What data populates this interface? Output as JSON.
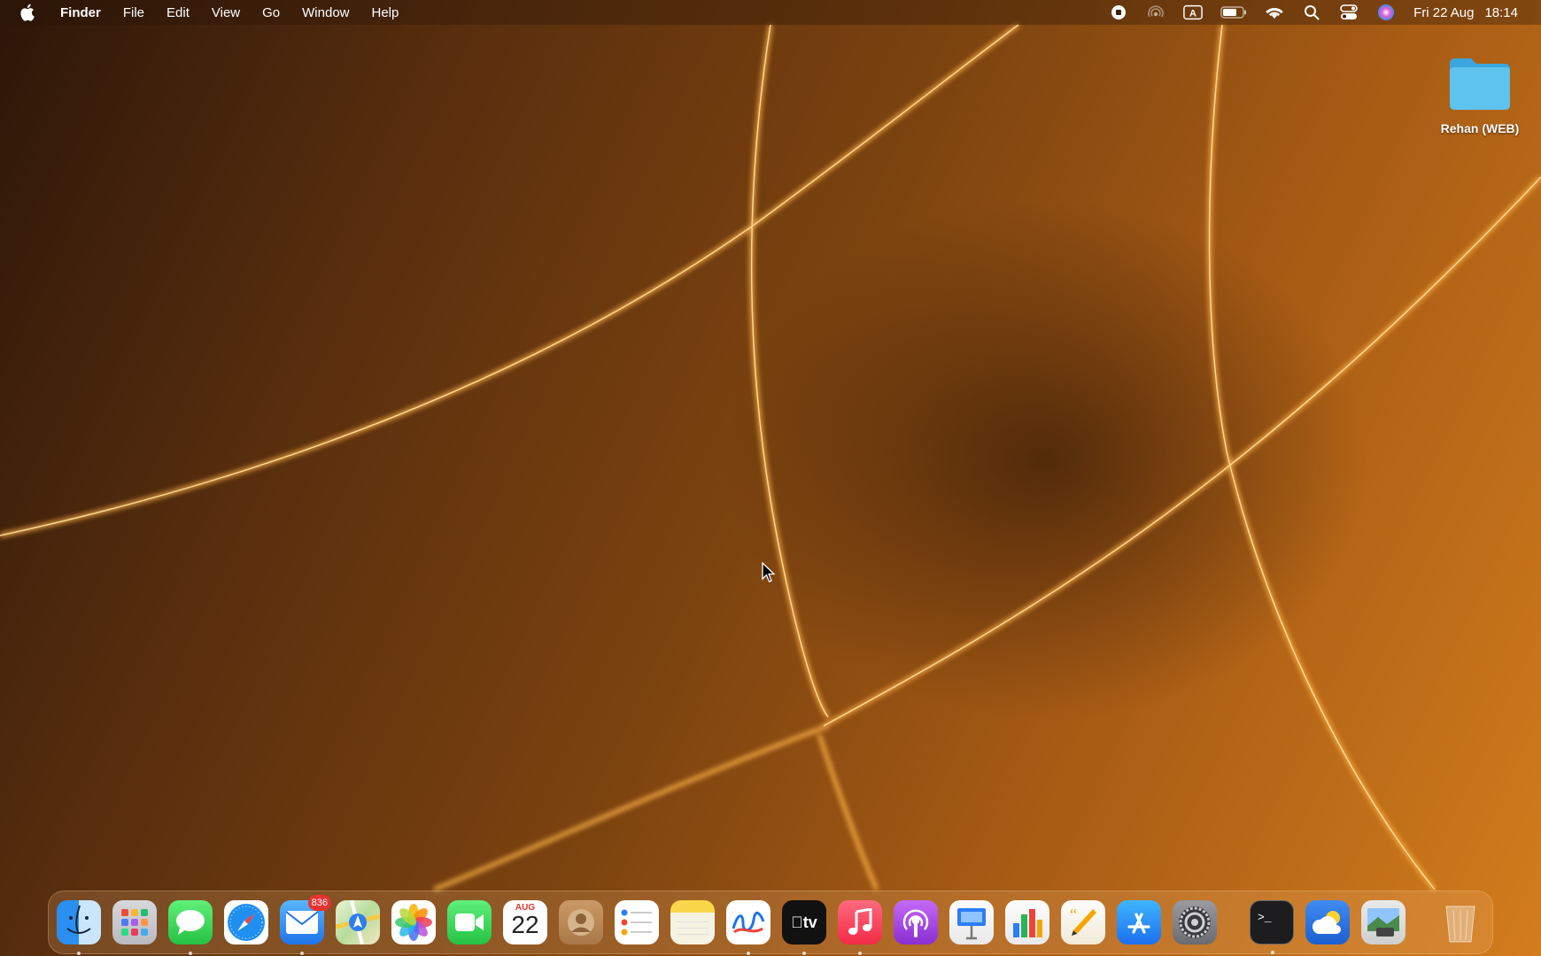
{
  "menubar": {
    "apple_icon": "apple-logo-icon",
    "app_name": "Finder",
    "menus": [
      "File",
      "Edit",
      "View",
      "Go",
      "Window",
      "Help"
    ],
    "status_icons": [
      "screen-record-icon",
      "airdrop-icon",
      "keyboard-input-icon",
      "battery-icon",
      "wifi-icon",
      "spotlight-search-icon",
      "control-center-icon",
      "siri-icon"
    ],
    "input_source_letter": "A",
    "date": "Fri 22 Aug",
    "time": "18:14"
  },
  "desktop": {
    "folder_label": "Rehan (WEB)",
    "folder_color": "#5ec3ef"
  },
  "dock": {
    "mail_badge": "836",
    "calendar_month": "AUG",
    "calendar_day": "22",
    "apps": [
      "Finder",
      "Launchpad",
      "Messages",
      "Safari",
      "Mail",
      "Maps",
      "Photos",
      "FaceTime",
      "Calendar",
      "Contacts",
      "Reminders",
      "Notes",
      "Freeform",
      "TV",
      "Music",
      "Podcasts",
      "Keynote",
      "Numbers",
      "Pages",
      "App Store",
      "System Settings",
      "Terminal",
      "Weather",
      "Preview",
      "Trash"
    ]
  }
}
